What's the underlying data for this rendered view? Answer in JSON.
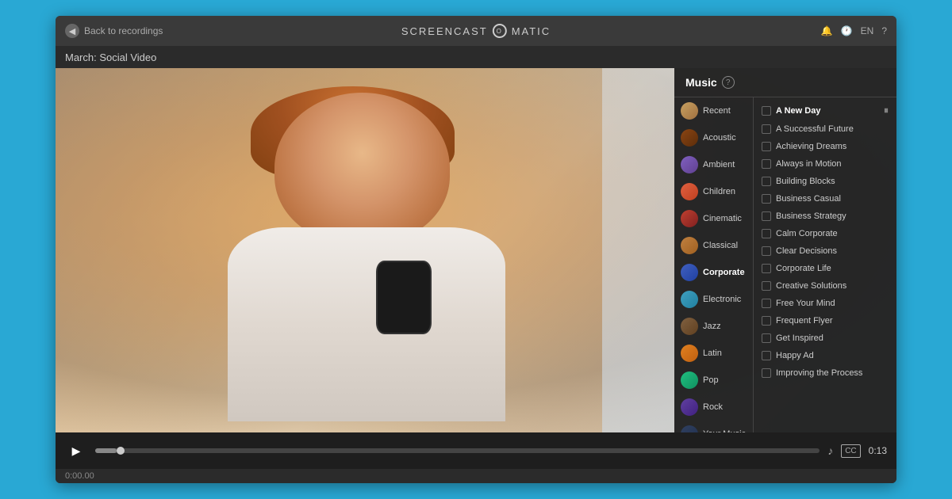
{
  "titleBar": {
    "backLabel": "Back to recordings",
    "logoText": "SCREENCAST",
    "logoMid": "O",
    "logoRight": "MATIC",
    "langLabel": "EN",
    "helpIcon": "?"
  },
  "subtitle": "March: Social Video",
  "controls": {
    "playIcon": "▶",
    "musicIcon": "♪",
    "ccLabel": "CC",
    "timeDisplay": "0:13",
    "timeStart": "0:00.00",
    "pauseIcon": "⏸"
  },
  "musicPanel": {
    "title": "Music",
    "helpIcon": "?",
    "categories": [
      {
        "id": "recent",
        "label": "Recent",
        "colorClass": "cat-recent"
      },
      {
        "id": "acoustic",
        "label": "Acoustic",
        "colorClass": "cat-acoustic"
      },
      {
        "id": "ambient",
        "label": "Ambient",
        "colorClass": "cat-ambient"
      },
      {
        "id": "children",
        "label": "Children",
        "colorClass": "cat-children"
      },
      {
        "id": "cinematic",
        "label": "Cinematic",
        "colorClass": "cat-cinematic"
      },
      {
        "id": "classical",
        "label": "Classical",
        "colorClass": "cat-classical"
      },
      {
        "id": "corporate",
        "label": "Corporate",
        "colorClass": "cat-corporate",
        "active": true
      },
      {
        "id": "electronic",
        "label": "Electronic",
        "colorClass": "cat-electronic"
      },
      {
        "id": "jazz",
        "label": "Jazz",
        "colorClass": "cat-jazz"
      },
      {
        "id": "latin",
        "label": "Latin",
        "colorClass": "cat-latin"
      },
      {
        "id": "pop",
        "label": "Pop",
        "colorClass": "cat-pop"
      },
      {
        "id": "rock",
        "label": "Rock",
        "colorClass": "cat-rock"
      },
      {
        "id": "yourmusic",
        "label": "Your Music",
        "colorClass": "cat-yourmusic"
      }
    ],
    "tracks": [
      {
        "id": "a-new-day",
        "label": "A New Day",
        "playing": true
      },
      {
        "id": "a-successful-future",
        "label": "A Successful Future",
        "playing": false
      },
      {
        "id": "achieving-dreams",
        "label": "Achieving Dreams",
        "playing": false
      },
      {
        "id": "always-in-motion",
        "label": "Always in Motion",
        "playing": false
      },
      {
        "id": "building-blocks",
        "label": "Building Blocks",
        "playing": false
      },
      {
        "id": "business-casual",
        "label": "Business Casual",
        "playing": false
      },
      {
        "id": "business-strategy",
        "label": "Business Strategy",
        "playing": false
      },
      {
        "id": "calm-corporate",
        "label": "Calm Corporate",
        "playing": false
      },
      {
        "id": "clear-decisions",
        "label": "Clear Decisions",
        "playing": false
      },
      {
        "id": "corporate-life",
        "label": "Corporate Life",
        "playing": false
      },
      {
        "id": "creative-solutions",
        "label": "Creative Solutions",
        "playing": false
      },
      {
        "id": "free-your-mind",
        "label": "Free Your Mind",
        "playing": false
      },
      {
        "id": "frequent-flyer",
        "label": "Frequent Flyer",
        "playing": false
      },
      {
        "id": "get-inspired",
        "label": "Get Inspired",
        "playing": false
      },
      {
        "id": "happy-ad",
        "label": "Happy Ad",
        "playing": false
      },
      {
        "id": "improving-the-process",
        "label": "Improving the Process",
        "playing": false
      }
    ]
  }
}
